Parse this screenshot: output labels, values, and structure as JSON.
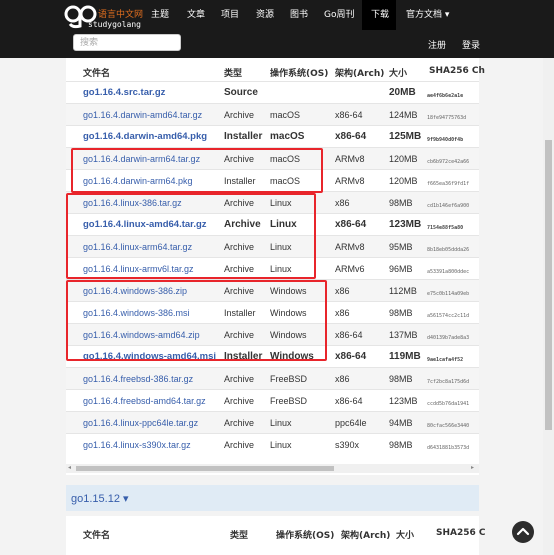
{
  "brand": {
    "cn": "语言中文网",
    "en": "studygolang"
  },
  "nav": {
    "items": [
      "主题",
      "文章",
      "项目",
      "资源",
      "图书",
      "Go周刊",
      "下载",
      "官方文档 ▾"
    ],
    "active": "下载",
    "search_placeholder": "搜索",
    "register": "注册",
    "login": "登录"
  },
  "table": {
    "headers": [
      "文件名",
      "类型",
      "操作系统(OS)",
      "架构(Arch)",
      "大小",
      "SHA256 Ch"
    ],
    "rows": [
      {
        "name": "go1.16.4.src.tar.gz",
        "kind": "Source",
        "os": "",
        "arch": "",
        "size": "20MB",
        "sha": "ae4f6b6e2a1e",
        "bold": true
      },
      {
        "name": "go1.16.4.darwin-amd64.tar.gz",
        "kind": "Archive",
        "os": "macOS",
        "arch": "x86-64",
        "size": "124MB",
        "sha": "18fe94775763d",
        "bold": false
      },
      {
        "name": "go1.16.4.darwin-amd64.pkg",
        "kind": "Installer",
        "os": "macOS",
        "arch": "x86-64",
        "size": "125MB",
        "sha": "9f9b940d0f4b",
        "bold": true
      },
      {
        "name": "go1.16.4.darwin-arm64.tar.gz",
        "kind": "Archive",
        "os": "macOS",
        "arch": "ARMv8",
        "size": "120MB",
        "sha": "cb6b972ce42a66",
        "bold": false
      },
      {
        "name": "go1.16.4.darwin-arm64.pkg",
        "kind": "Installer",
        "os": "macOS",
        "arch": "ARMv8",
        "size": "120MB",
        "sha": "f665ea36f9fd1f",
        "bold": false
      },
      {
        "name": "go1.16.4.linux-386.tar.gz",
        "kind": "Archive",
        "os": "Linux",
        "arch": "x86",
        "size": "98MB",
        "sha": "cd1b146ef6a900",
        "bold": false
      },
      {
        "name": "go1.16.4.linux-amd64.tar.gz",
        "kind": "Archive",
        "os": "Linux",
        "arch": "x86-64",
        "size": "123MB",
        "sha": "7154e88f5a80",
        "bold": true
      },
      {
        "name": "go1.16.4.linux-arm64.tar.gz",
        "kind": "Archive",
        "os": "Linux",
        "arch": "ARMv8",
        "size": "95MB",
        "sha": "8b18eb05ddda26",
        "bold": false
      },
      {
        "name": "go1.16.4.linux-armv6l.tar.gz",
        "kind": "Archive",
        "os": "Linux",
        "arch": "ARMv6",
        "size": "96MB",
        "sha": "a53391a800ddec",
        "bold": false
      },
      {
        "name": "go1.16.4.windows-386.zip",
        "kind": "Archive",
        "os": "Windows",
        "arch": "x86",
        "size": "112MB",
        "sha": "e75c0b114a09eb",
        "bold": false
      },
      {
        "name": "go1.16.4.windows-386.msi",
        "kind": "Installer",
        "os": "Windows",
        "arch": "x86",
        "size": "98MB",
        "sha": "a561574cc2c11d",
        "bold": false
      },
      {
        "name": "go1.16.4.windows-amd64.zip",
        "kind": "Archive",
        "os": "Windows",
        "arch": "x86-64",
        "size": "137MB",
        "sha": "d40139b7ade8a3",
        "bold": false
      },
      {
        "name": "go1.16.4.windows-amd64.msi",
        "kind": "Installer",
        "os": "Windows",
        "arch": "x86-64",
        "size": "119MB",
        "sha": "9ae1cafa4f52",
        "bold": true
      },
      {
        "name": "go1.16.4.freebsd-386.tar.gz",
        "kind": "Archive",
        "os": "FreeBSD",
        "arch": "x86",
        "size": "98MB",
        "sha": "7cf2bc8a175d6d",
        "bold": false
      },
      {
        "name": "go1.16.4.freebsd-amd64.tar.gz",
        "kind": "Archive",
        "os": "FreeBSD",
        "arch": "x86-64",
        "size": "123MB",
        "sha": "ccdd5b76da1941",
        "bold": false
      },
      {
        "name": "go1.16.4.linux-ppc64le.tar.gz",
        "kind": "Archive",
        "os": "Linux",
        "arch": "ppc64le",
        "size": "94MB",
        "sha": "80cfac566e3440",
        "bold": false
      },
      {
        "name": "go1.16.4.linux-s390x.tar.gz",
        "kind": "Archive",
        "os": "Linux",
        "arch": "s390x",
        "size": "98MB",
        "sha": "d6431881b3573d",
        "bold": false
      }
    ]
  },
  "next_version": {
    "label": "go1.15.12 ▾",
    "headers": [
      "文件名",
      "类型",
      "操作系统(OS)",
      "架构(Arch)",
      "大小",
      "SHA256 C"
    ]
  },
  "colors": {
    "link": "#375eab",
    "highlight": "#e8252b",
    "navbar": "#1a1a1a",
    "brand": "#e06e1f"
  },
  "icons": {
    "back_to_top": "chevron-up-icon",
    "scroll_left": "arrow-left-icon",
    "scroll_right": "arrow-right-icon"
  }
}
